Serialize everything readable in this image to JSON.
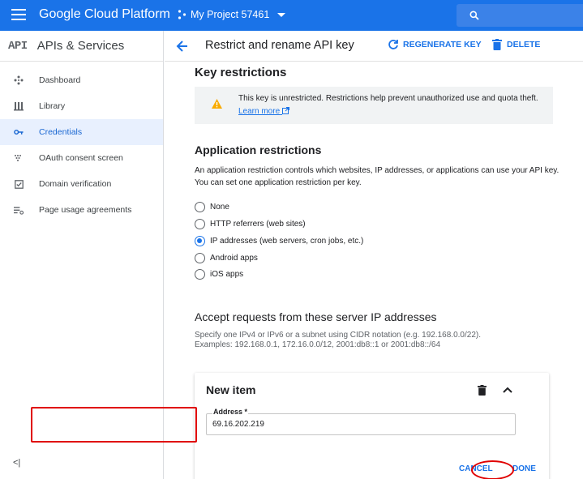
{
  "topbar": {
    "brand": "Google Cloud Platform",
    "project": "My Project 57461",
    "color": "#1a73e8"
  },
  "sidebar": {
    "api_badge": "API",
    "title": "APIs & Services",
    "items": [
      {
        "label": "Dashboard",
        "icon": "dashboard-icon",
        "active": false
      },
      {
        "label": "Library",
        "icon": "library-icon",
        "active": false
      },
      {
        "label": "Credentials",
        "icon": "key-icon",
        "active": true
      },
      {
        "label": "OAuth consent screen",
        "icon": "consent-icon",
        "active": false
      },
      {
        "label": "Domain verification",
        "icon": "checkbox-icon",
        "active": false
      },
      {
        "label": "Page usage agreements",
        "icon": "settings-list-icon",
        "active": false
      }
    ],
    "collapse": "<|"
  },
  "subheader": {
    "title": "Restrict and rename API key",
    "regenerate": "REGENERATE KEY",
    "delete": "DELETE"
  },
  "main": {
    "key_restrictions": "Key restrictions",
    "notice": "This key is unrestricted. Restrictions help prevent unauthorized use and quota theft.",
    "learn_more": "Learn more",
    "app_restrictions_title": "Application restrictions",
    "app_restrictions_desc1": "An application restriction controls which websites, IP addresses, or applications can use your API key.",
    "app_restrictions_desc2": "You can set one application restriction per key.",
    "options": [
      {
        "label": "None",
        "checked": false
      },
      {
        "label": "HTTP referrers (web sites)",
        "checked": false
      },
      {
        "label": "IP addresses (web servers, cron jobs, etc.)",
        "checked": true
      },
      {
        "label": "Android apps",
        "checked": false
      },
      {
        "label": "iOS apps",
        "checked": false
      }
    ],
    "accept_title": "Accept requests from these server IP addresses",
    "accept_desc1": "Specify one IPv4 or IPv6 or a subnet using CIDR notation (e.g. 192.168.0.0/22).",
    "accept_desc2": "Examples: 192.168.0.1, 172.16.0.0/12, 2001:db8::1 or 2001:db8::/64",
    "card": {
      "title": "New item",
      "address_label": "Address *",
      "address_value": "69.16.202.219",
      "cancel": "CANCEL",
      "done": "DONE"
    }
  }
}
